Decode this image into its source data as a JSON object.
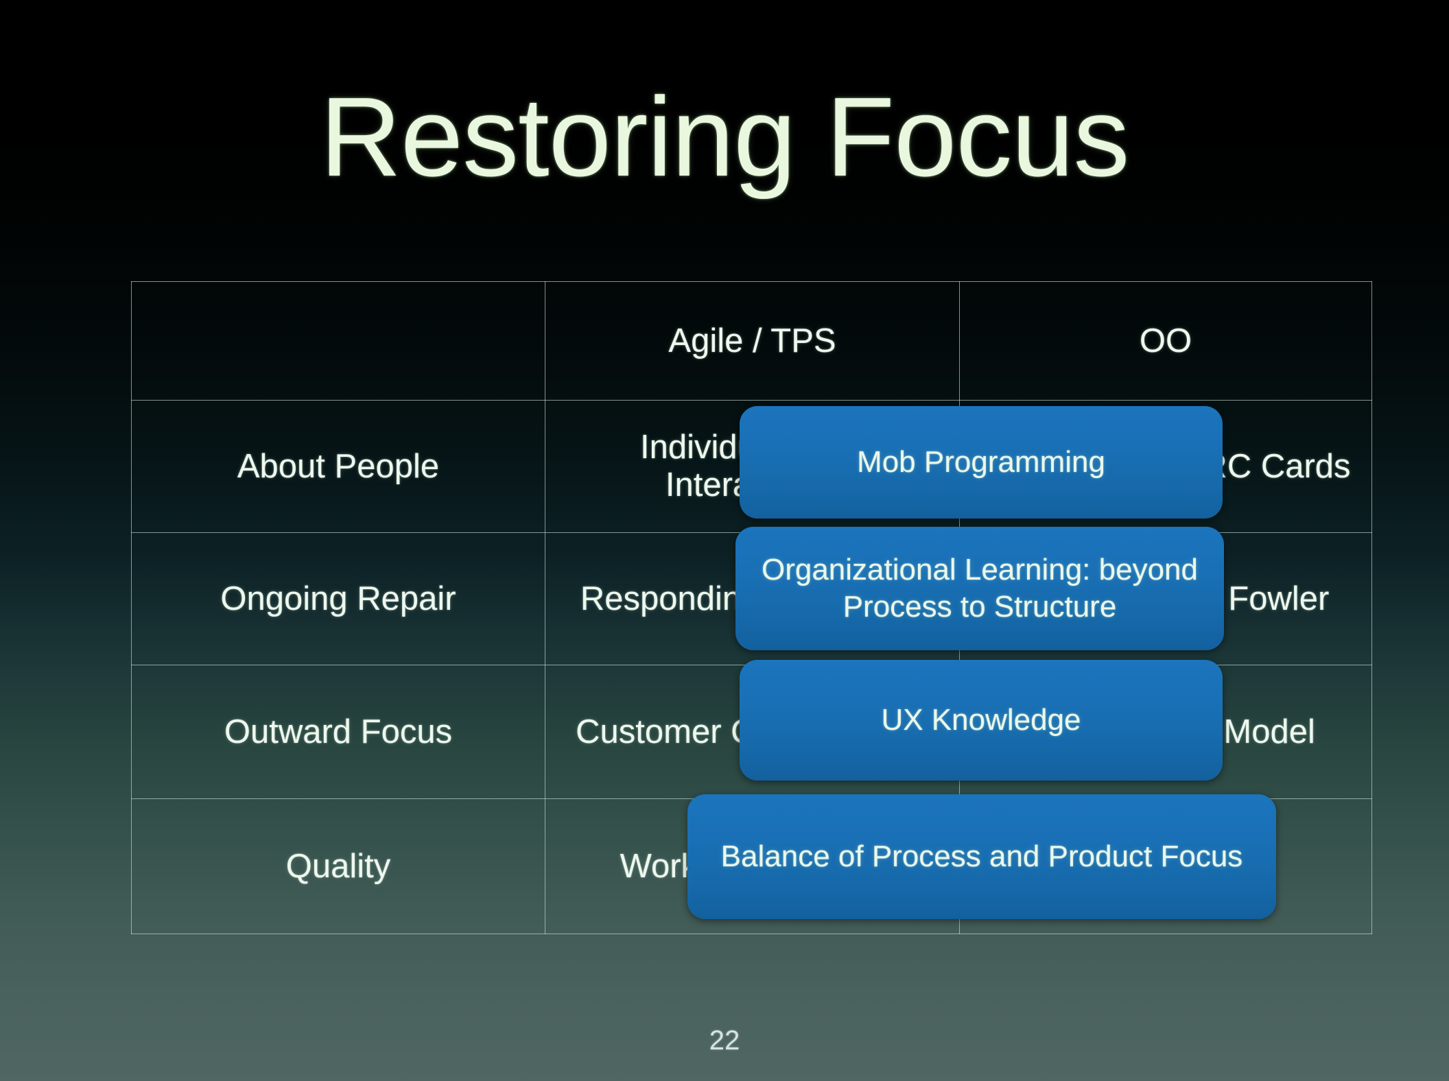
{
  "slide": {
    "title": "Restoring Focus",
    "page_number": "22",
    "accent_color": "#1a70b6",
    "text_color": "#eef8ef",
    "background_top_color": "#000000",
    "background_bottom_color": "#4f6662"
  },
  "table": {
    "columns": [
      "",
      "Agile / TPS",
      "OO"
    ],
    "rows": [
      {
        "label": "About People",
        "agile": "Individuals and Interactions",
        "oo": "Dynamic UC\nCRC Cards"
      },
      {
        "label": "Ongoing Repair",
        "agile": "Responding to Change",
        "oo": "Refactoring by\nFowler"
      },
      {
        "label": "Outward Focus",
        "agile": "Customer Collaboration",
        "oo": "Users\nMental Model"
      },
      {
        "label": "Quality",
        "agile": "Working Software",
        "oo": ""
      }
    ]
  },
  "callouts": [
    {
      "label": "Mob Programming"
    },
    {
      "label": "Organizational Learning: beyond Process to Structure"
    },
    {
      "label": "UX Knowledge"
    },
    {
      "label": "Balance of Process and Product Focus"
    }
  ]
}
